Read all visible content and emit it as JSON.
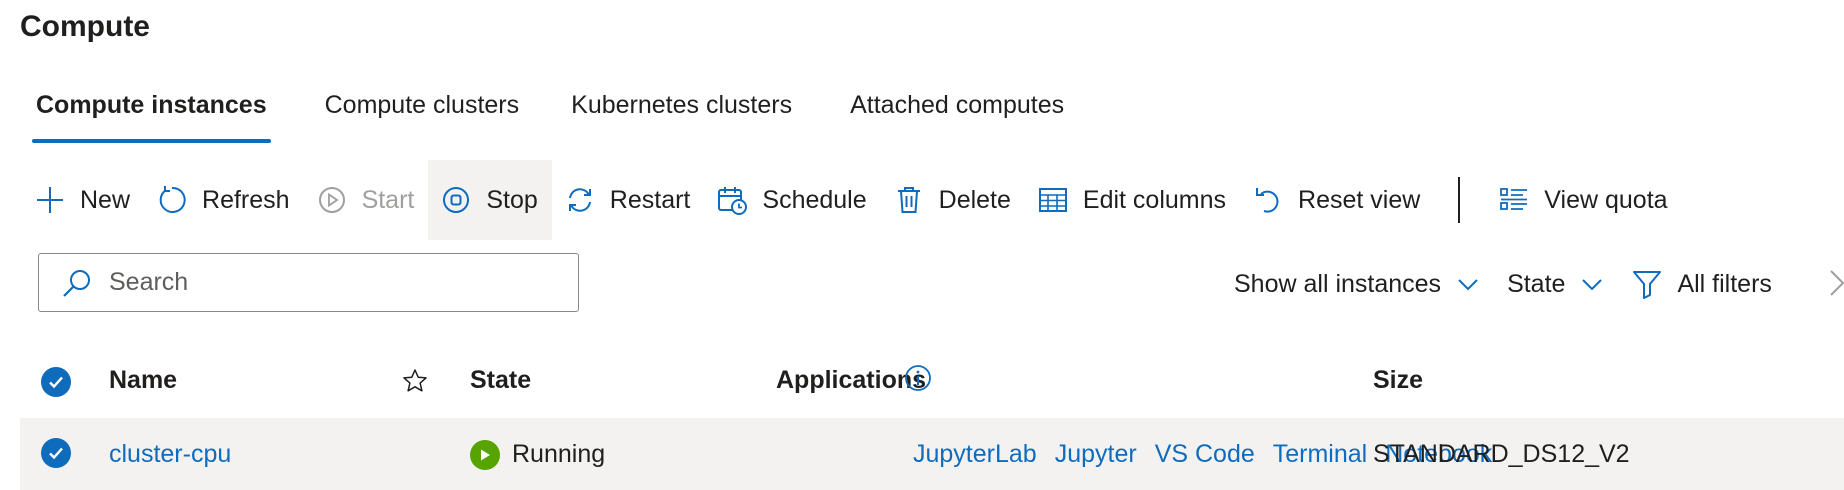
{
  "page": {
    "title": "Compute"
  },
  "tabs": [
    {
      "label": "Compute instances",
      "active": true
    },
    {
      "label": "Compute clusters",
      "active": false
    },
    {
      "label": "Kubernetes clusters",
      "active": false
    },
    {
      "label": "Attached computes",
      "active": false
    }
  ],
  "toolbar": {
    "new": "New",
    "refresh": "Refresh",
    "start": "Start",
    "stop": "Stop",
    "restart": "Restart",
    "schedule": "Schedule",
    "delete": "Delete",
    "edit_columns": "Edit columns",
    "reset_view": "Reset view",
    "view_quota": "View quota"
  },
  "search": {
    "placeholder": "Search",
    "value": ""
  },
  "filters": {
    "instances": "Show all instances",
    "state": "State",
    "all_filters": "All filters"
  },
  "table": {
    "columns": {
      "name": "Name",
      "state": "State",
      "applications": "Applications",
      "size": "Size"
    },
    "rows": [
      {
        "name": "cluster-cpu",
        "state": "Running",
        "applications": [
          "JupyterLab",
          "Jupyter",
          "VS Code",
          "Terminal",
          "Notebook"
        ],
        "size": "STANDARD_DS12_V2"
      }
    ]
  },
  "colors": {
    "accent": "#0f6cbd",
    "running": "#57a300",
    "disabled": "#a19f9d",
    "row_selected_bg": "#f3f2f1"
  }
}
